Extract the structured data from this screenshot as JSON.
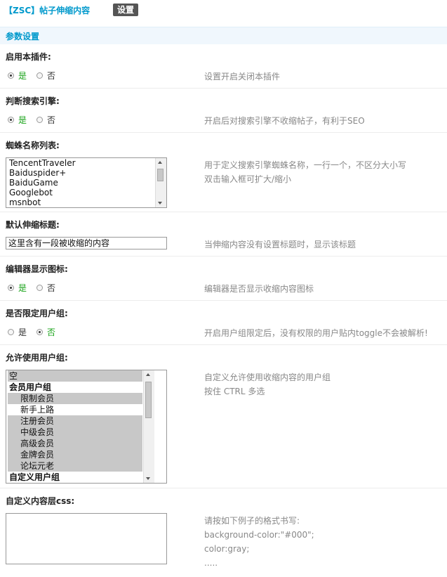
{
  "header": {
    "plugin_title": "【ZSC】帖子伸缩内容",
    "settings_button": "设置"
  },
  "section": {
    "title": "参数设置"
  },
  "settings": {
    "enable": {
      "label": "启用本插件:",
      "yes": "是",
      "no": "否",
      "value": "yes",
      "hint": "设置开启关闭本插件"
    },
    "search_engine": {
      "label": "判断搜索引擎:",
      "yes": "是",
      "no": "否",
      "value": "yes",
      "hint": "开启后对搜索引擎不收缩帖子，有利于SEO"
    },
    "spiders": {
      "label": "蜘蛛名称列表:",
      "lines": [
        "TencentTraveler",
        "Baiduspider+",
        "BaiduGame",
        "Googlebot",
        "msnbot"
      ],
      "hints": [
        "用于定义搜索引擎蜘蛛名称，一行一个，不区分大小写",
        "双击输入框可扩大/缩小"
      ]
    },
    "default_title": {
      "label": "默认伸缩标题:",
      "value": "这里含有一段被收缩的内容",
      "hint": "当伸缩内容没有设置标题时，显示该标题"
    },
    "editor_icon": {
      "label": "编辑器显示图标:",
      "yes": "是",
      "no": "否",
      "value": "yes",
      "hint": "编辑器是否显示收缩内容图标"
    },
    "limit_group": {
      "label": "是否限定用户组:",
      "yes": "是",
      "no": "否",
      "value": "no",
      "hint": "开启用户组限定后，没有权限的用户贴内toggle不会被解析!"
    },
    "allowed_groups": {
      "label": "允许使用用户组:",
      "options": [
        {
          "text": "空",
          "type": "item",
          "selected": true
        },
        {
          "text": "会员用户组",
          "type": "group",
          "selected": false
        },
        {
          "text": "限制会员",
          "type": "sub",
          "selected": true
        },
        {
          "text": "新手上路",
          "type": "sub",
          "selected": false
        },
        {
          "text": "注册会员",
          "type": "sub",
          "selected": true
        },
        {
          "text": "中级会员",
          "type": "sub",
          "selected": true
        },
        {
          "text": "高级会员",
          "type": "sub",
          "selected": true
        },
        {
          "text": "金牌会员",
          "type": "sub",
          "selected": true
        },
        {
          "text": "论坛元老",
          "type": "sub",
          "selected": true
        },
        {
          "text": "自定义用户组",
          "type": "group",
          "selected": false
        }
      ],
      "hints": [
        "自定义允许使用收缩内容的用户组",
        "按住 CTRL 多选"
      ]
    },
    "custom_css": {
      "label": "自定义内容层css:",
      "value": "",
      "hints": [
        "请按如下例子的格式书写:",
        "background-color:\"#000\";",
        "color:gray;",
        "....."
      ]
    }
  },
  "colors": {
    "accent": "#0099cc",
    "selected_option": "#19a319",
    "section_bg": "#f0f7fd"
  }
}
